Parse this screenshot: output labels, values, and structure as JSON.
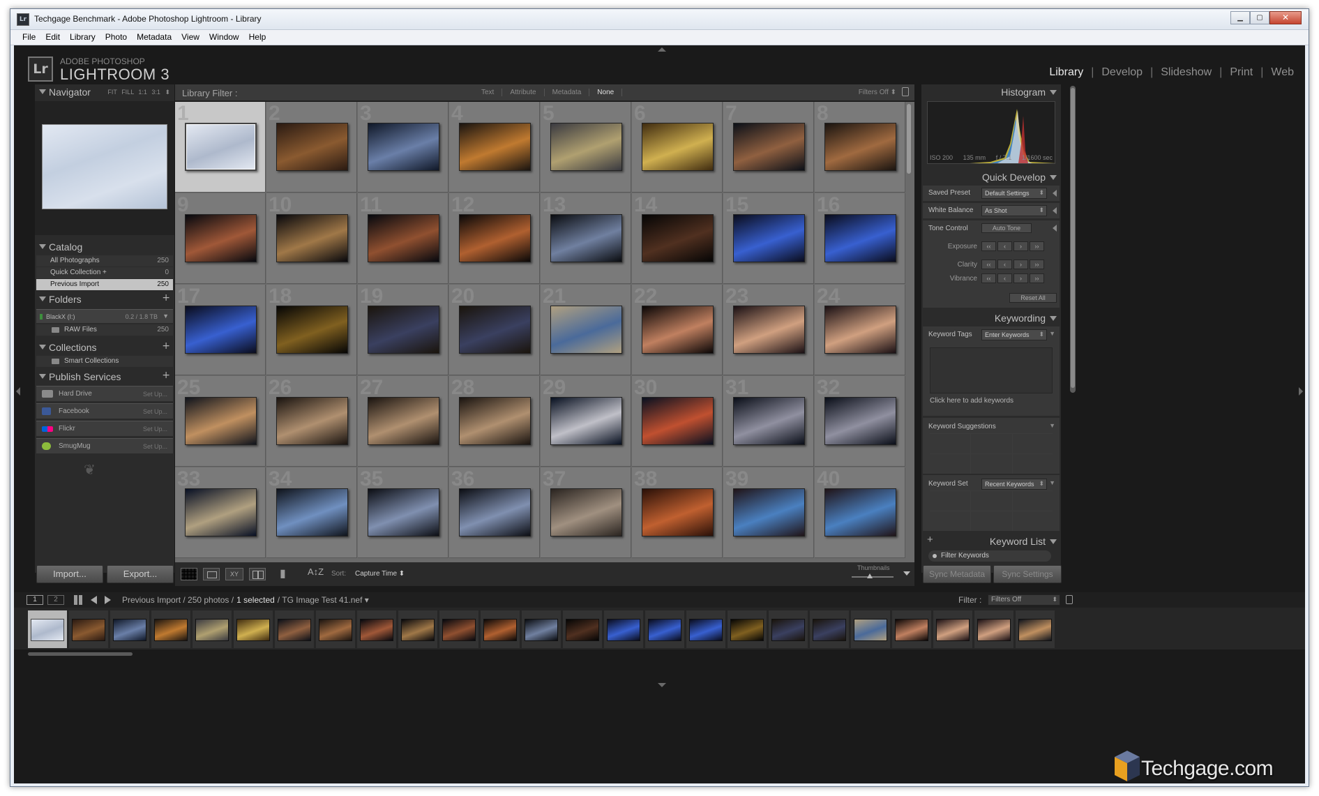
{
  "window": {
    "title": "Techgage Benchmark - Adobe Photoshop Lightroom - Library",
    "app_icon": "Lr",
    "minimize": "▁",
    "maximize": "▢",
    "close": "✕"
  },
  "menu": [
    "File",
    "Edit",
    "Library",
    "Photo",
    "Metadata",
    "View",
    "Window",
    "Help"
  ],
  "identity": {
    "logo": "Lr",
    "small": "ADOBE PHOTOSHOP",
    "big": "LIGHTROOM 3"
  },
  "modules": [
    {
      "label": "Library",
      "active": true
    },
    {
      "label": "Develop",
      "active": false
    },
    {
      "label": "Slideshow",
      "active": false
    },
    {
      "label": "Print",
      "active": false
    },
    {
      "label": "Web",
      "active": false
    }
  ],
  "module_sep": "|",
  "navigator": {
    "title": "Navigator",
    "zoom": [
      "FIT",
      "FILL",
      "1:1",
      "3:1"
    ],
    "zoom_caret": "⬍"
  },
  "catalog": {
    "title": "Catalog",
    "items": [
      {
        "label": "All Photographs",
        "count": "250",
        "selected": false
      },
      {
        "label": "Quick Collection +",
        "count": "0",
        "selected": false
      },
      {
        "label": "Previous Import",
        "count": "250",
        "selected": true
      }
    ]
  },
  "folders": {
    "title": "Folders",
    "plus": "+",
    "drive": {
      "label": "BlackX (I:)",
      "space": "0.2 / 1.8 TB",
      "caret": "▼"
    },
    "items": [
      {
        "label": "RAW Files",
        "count": "250"
      }
    ]
  },
  "collections": {
    "title": "Collections",
    "plus": "+",
    "items": [
      {
        "label": "Smart Collections"
      }
    ]
  },
  "publish": {
    "title": "Publish Services",
    "plus": "+",
    "items": [
      {
        "label": "Hard Drive",
        "action": "Set Up...",
        "color": "#8a8a8a"
      },
      {
        "label": "Facebook",
        "action": "Set Up...",
        "color": "#3b5998"
      },
      {
        "label": "Flickr",
        "action": "Set Up...",
        "color": "#ff0084"
      },
      {
        "label": "SmugMug",
        "action": "Set Up...",
        "color": "#8cbc3c"
      }
    ]
  },
  "ornament": "❦",
  "buttons": {
    "import": "Import...",
    "export": "Export...",
    "sync_metadata": "Sync Metadata",
    "sync_settings": "Sync Settings"
  },
  "filter_bar": {
    "title": "Library Filter :",
    "tabs": [
      {
        "label": "Text",
        "active": false
      },
      {
        "label": "Attribute",
        "active": false
      },
      {
        "label": "Metadata",
        "active": false
      },
      {
        "label": "None",
        "active": true
      }
    ],
    "status": "Filters Off ⬍"
  },
  "grid": {
    "columns": 8,
    "selected": 1,
    "cells": [
      {
        "n": "1",
        "c": [
          "#e4e9f2",
          "#aeb9cc"
        ]
      },
      {
        "n": "2",
        "c": [
          "#2a1a12",
          "#8a5a30"
        ]
      },
      {
        "n": "3",
        "c": [
          "#101828",
          "#6a7fa8"
        ]
      },
      {
        "n": "4",
        "c": [
          "#1a1410",
          "#c07a30"
        ]
      },
      {
        "n": "5",
        "c": [
          "#3a3a40",
          "#b0a070"
        ]
      },
      {
        "n": "6",
        "c": [
          "#402c10",
          "#d0b050"
        ]
      },
      {
        "n": "7",
        "c": [
          "#0c1018",
          "#906040"
        ]
      },
      {
        "n": "8",
        "c": [
          "#1a1410",
          "#a06a40"
        ]
      },
      {
        "n": "9",
        "c": [
          "#06080e",
          "#a05838"
        ]
      },
      {
        "n": "10",
        "c": [
          "#08080c",
          "#a07848"
        ]
      },
      {
        "n": "11",
        "c": [
          "#06080e",
          "#905030"
        ]
      },
      {
        "n": "12",
        "c": [
          "#0a0808",
          "#b06030"
        ]
      },
      {
        "n": "13",
        "c": [
          "#0a0c10",
          "#7080a0"
        ]
      },
      {
        "n": "14",
        "c": [
          "#050505",
          "#503020"
        ]
      },
      {
        "n": "15",
        "c": [
          "#0a0c1c",
          "#3860d0"
        ]
      },
      {
        "n": "16",
        "c": [
          "#0a0c1c",
          "#3860d0"
        ]
      },
      {
        "n": "17",
        "c": [
          "#0a0c1c",
          "#3860d0"
        ]
      },
      {
        "n": "18",
        "c": [
          "#050505",
          "#806020"
        ]
      },
      {
        "n": "19",
        "c": [
          "#1a140c",
          "#3a4060"
        ]
      },
      {
        "n": "20",
        "c": [
          "#1a140c",
          "#3a4060"
        ]
      },
      {
        "n": "21",
        "c": [
          "#b0a080",
          "#4a6a9a"
        ]
      },
      {
        "n": "22",
        "c": [
          "#0a0606",
          "#c08060"
        ]
      },
      {
        "n": "23",
        "c": [
          "#1a1014",
          "#d0a080"
        ]
      },
      {
        "n": "24",
        "c": [
          "#1a1014",
          "#d0a080"
        ]
      },
      {
        "n": "25",
        "c": [
          "#10141c",
          "#c09060"
        ]
      },
      {
        "n": "26",
        "c": [
          "#1a1410",
          "#b09070"
        ]
      },
      {
        "n": "27",
        "c": [
          "#1a1410",
          "#b09070"
        ]
      },
      {
        "n": "28",
        "c": [
          "#1a1410",
          "#b09070"
        ]
      },
      {
        "n": "29",
        "c": [
          "#081020",
          "#c0c0c8"
        ]
      },
      {
        "n": "30",
        "c": [
          "#081020",
          "#c05030"
        ]
      },
      {
        "n": "31",
        "c": [
          "#0a0e18",
          "#9090a0"
        ]
      },
      {
        "n": "32",
        "c": [
          "#0a0e18",
          "#9090a0"
        ]
      },
      {
        "n": "33",
        "c": [
          "#081024",
          "#b0a080"
        ]
      },
      {
        "n": "34",
        "c": [
          "#10141c",
          "#7090c0"
        ]
      },
      {
        "n": "35",
        "c": [
          "#0c0e14",
          "#8090b0"
        ]
      },
      {
        "n": "36",
        "c": [
          "#0c0e14",
          "#8090b0"
        ]
      },
      {
        "n": "37",
        "c": [
          "#2a2420",
          "#a09080"
        ]
      },
      {
        "n": "38",
        "c": [
          "#2a1008",
          "#c06030"
        ]
      },
      {
        "n": "39",
        "c": [
          "#201418",
          "#4a80c0"
        ]
      },
      {
        "n": "40",
        "c": [
          "#201418",
          "#4a80c0"
        ]
      }
    ]
  },
  "toolbar": {
    "xy": "XY",
    "az": "A↕Z",
    "sort_label": "Sort:",
    "sort_value": "Capture Time ⬍",
    "thumbnails_label": "Thumbnails"
  },
  "histogram": {
    "title": "Histogram",
    "iso": "ISO 200",
    "focal": "135 mm",
    "aperture": "f / 7.1",
    "shutter": "1/1600 sec"
  },
  "quick_develop": {
    "title": "Quick Develop",
    "saved_preset_label": "Saved Preset",
    "saved_preset_value": "Default Settings",
    "white_balance_label": "White Balance",
    "white_balance_value": "As Shot",
    "tone_control_label": "Tone Control",
    "auto_tone": "Auto Tone",
    "exposure_label": "Exposure",
    "clarity_label": "Clarity",
    "vibrance_label": "Vibrance",
    "step_buttons": [
      "‹‹",
      "‹",
      "›",
      "››"
    ],
    "reset_all": "Reset All"
  },
  "keywording": {
    "title": "Keywording",
    "tags_label": "Keyword Tags",
    "tags_value": "Enter Keywords",
    "hint": "Click here to add keywords",
    "suggestions_label": "Keyword Suggestions",
    "set_label": "Keyword Set",
    "set_value": "Recent Keywords",
    "caret": "▼"
  },
  "keyword_list": {
    "title": "Keyword List",
    "plus": "+",
    "filter": "Filter Keywords"
  },
  "filmbar": {
    "screen1": "1",
    "screen2": "2",
    "path": "Previous Import / 250 photos /",
    "selected": "1 selected",
    "file": "/ TG Image Test 41.nef ▾",
    "filter_label": "Filter :",
    "filter_value": "Filters Off"
  },
  "filmstrip": {
    "selected": 0,
    "thumbs": [
      [
        "#e4e9f2",
        "#aeb9cc"
      ],
      [
        "#2a1a12",
        "#8a5a30"
      ],
      [
        "#101828",
        "#6a7fa8"
      ],
      [
        "#1a1410",
        "#c07a30"
      ],
      [
        "#3a3a40",
        "#b0a070"
      ],
      [
        "#402c10",
        "#d0b050"
      ],
      [
        "#0c1018",
        "#906040"
      ],
      [
        "#1a1410",
        "#a06a40"
      ],
      [
        "#06080e",
        "#a05838"
      ],
      [
        "#08080c",
        "#a07848"
      ],
      [
        "#06080e",
        "#905030"
      ],
      [
        "#0a0808",
        "#b06030"
      ],
      [
        "#0a0c10",
        "#7080a0"
      ],
      [
        "#050505",
        "#503020"
      ],
      [
        "#0a0c1c",
        "#3860d0"
      ],
      [
        "#0a0c1c",
        "#3860d0"
      ],
      [
        "#0a0c1c",
        "#3860d0"
      ],
      [
        "#050505",
        "#806020"
      ],
      [
        "#1a140c",
        "#3a4060"
      ],
      [
        "#1a140c",
        "#3a4060"
      ],
      [
        "#b0a080",
        "#4a6a9a"
      ],
      [
        "#0a0606",
        "#c08060"
      ],
      [
        "#1a1014",
        "#d0a080"
      ],
      [
        "#1a1014",
        "#d0a080"
      ],
      [
        "#10141c",
        "#c09060"
      ]
    ]
  },
  "watermark": "Techgage.com"
}
